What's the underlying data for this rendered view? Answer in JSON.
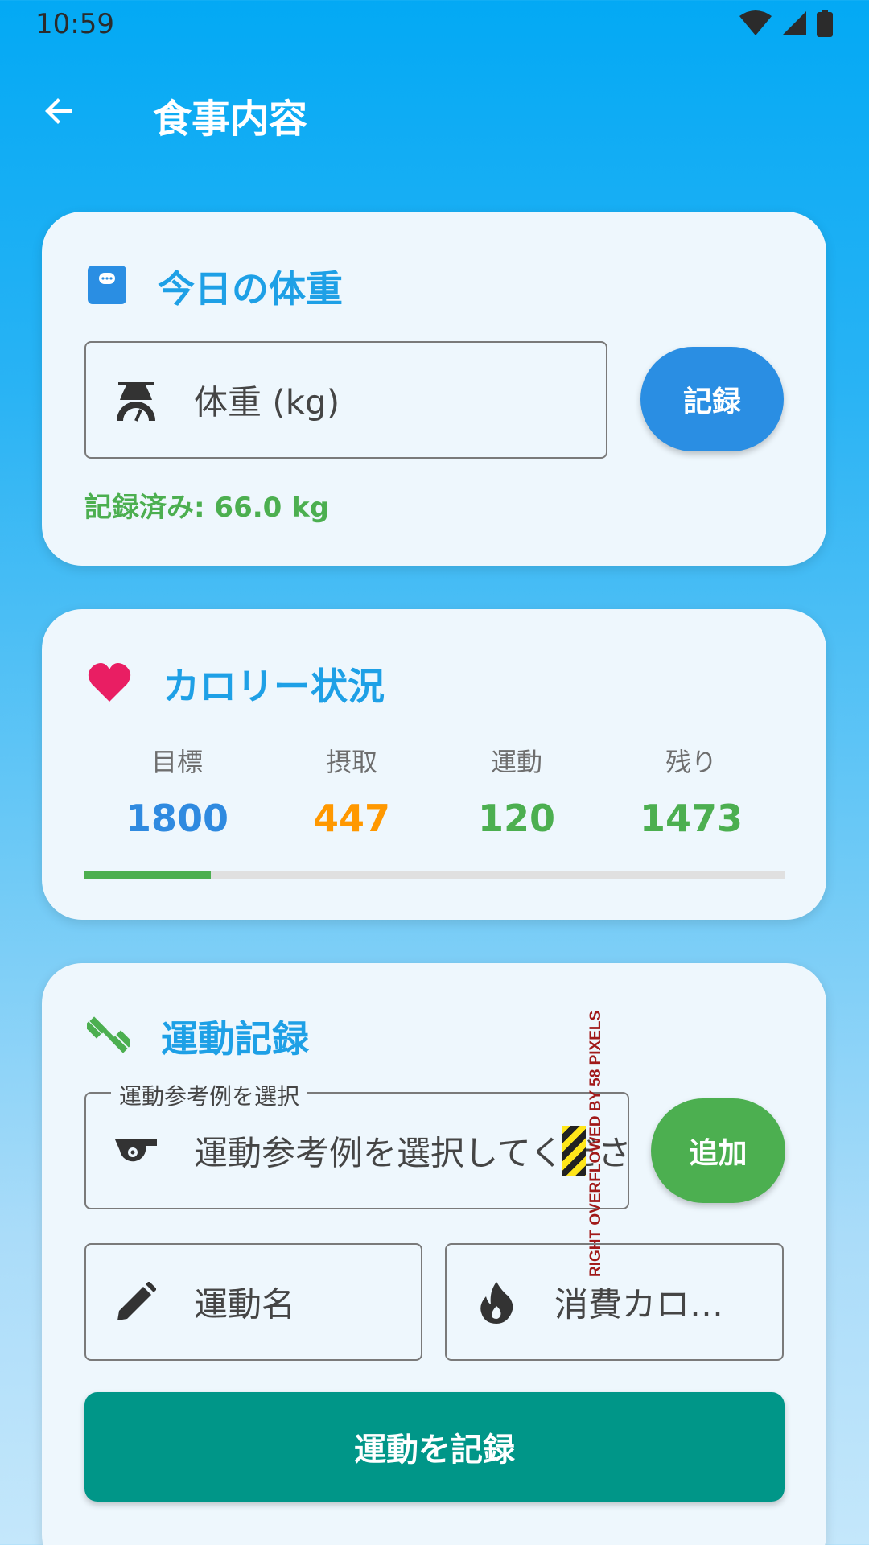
{
  "status_bar": {
    "time": "10:59"
  },
  "app_bar": {
    "title": "食事内容"
  },
  "weight_card": {
    "title": "今日の体重",
    "input_placeholder": "体重 (kg)",
    "button_label": "記録",
    "recorded_text": "記録済み: 66.0 kg"
  },
  "calorie_card": {
    "title": "カロリー状況",
    "stats": [
      {
        "label": "目標",
        "value": "1800",
        "color": "#2f8ae0"
      },
      {
        "label": "摂取",
        "value": "447",
        "color": "#ff9800"
      },
      {
        "label": "運動",
        "value": "120",
        "color": "#4caf50"
      },
      {
        "label": "残り",
        "value": "1473",
        "color": "#4caf50"
      }
    ],
    "progress_fraction": 0.18
  },
  "exercise_card": {
    "title": "運動記録",
    "dropdown_label": "運動参考例を選択",
    "dropdown_placeholder": "運動参考例を選択してください",
    "add_button_label": "追加",
    "exercise_name_placeholder": "運動名",
    "calories_placeholder": "消費カロ…",
    "submit_label": "運動を記録",
    "overflow_warning": "RIGHT OVERFLOWED BY 58 PIXELS"
  },
  "colors": {
    "accent": "#1ea0e6",
    "record_button": "#2a8ee3",
    "add_button": "#4caf50",
    "submit_button": "#009688",
    "heart": "#e91e63"
  },
  "icons": [
    "back-arrow-icon",
    "scale-icon",
    "heart-icon",
    "dumbbell-icon",
    "whistle-icon",
    "pencil-icon",
    "flame-icon",
    "wifi-icon",
    "signal-icon",
    "battery-icon"
  ]
}
